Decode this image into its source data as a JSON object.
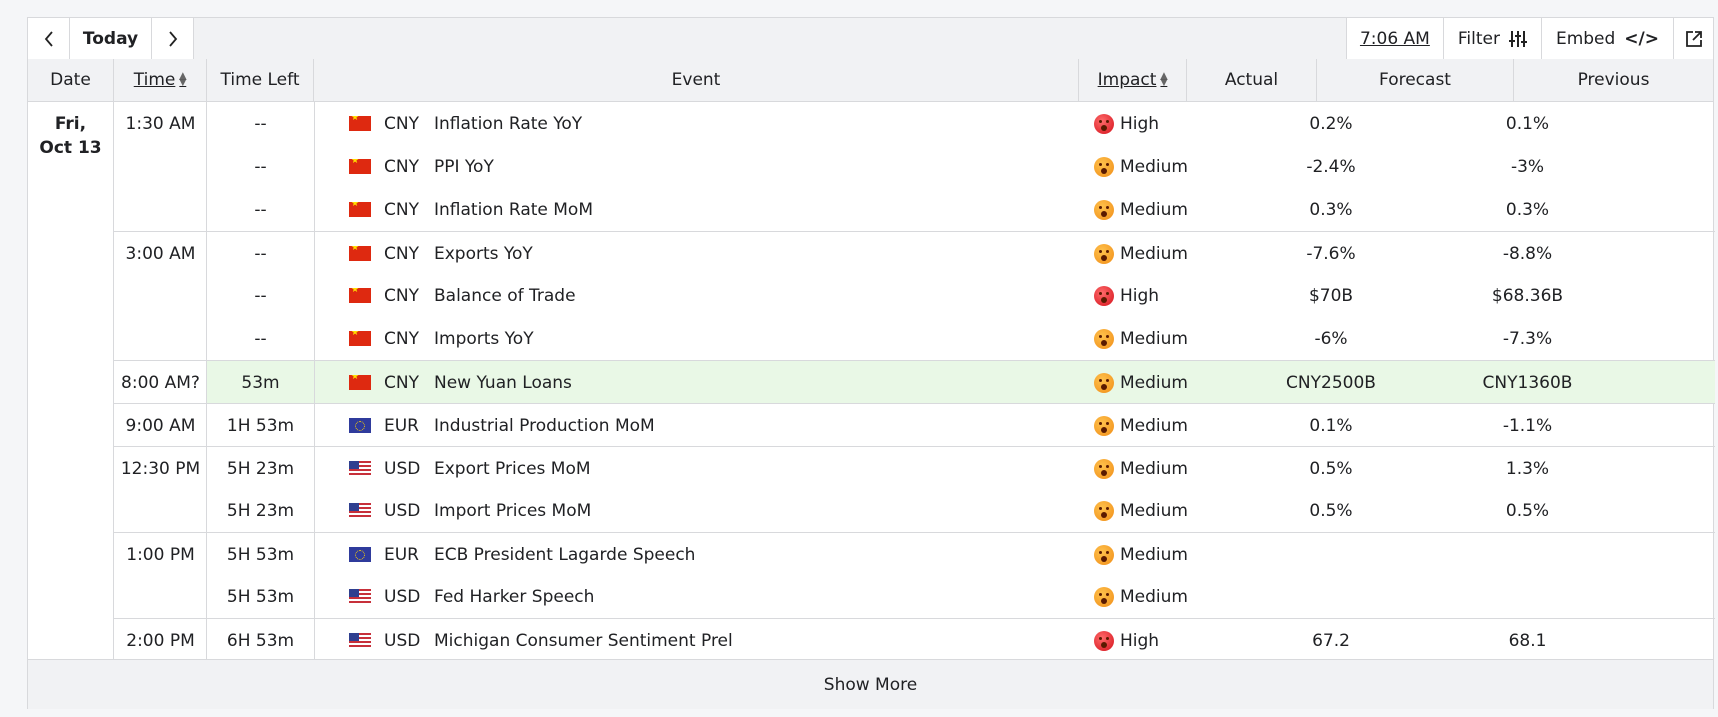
{
  "toolbar": {
    "today_label": "Today",
    "clock": "7:06 AM",
    "filter_label": "Filter",
    "embed_label": "Embed",
    "embed_code": "</>"
  },
  "headers": {
    "date": "Date",
    "time": "Time",
    "time_left": "Time Left",
    "event": "Event",
    "impact": "Impact",
    "actual": "Actual",
    "forecast": "Forecast",
    "previous": "Previous"
  },
  "date_group": {
    "weekday": "Fri,",
    "date": "Oct 13"
  },
  "rows": [
    {
      "time": "1:30 AM",
      "left": "--",
      "cur": "CNY",
      "flag": "cn",
      "event": "Inflation Rate YoY",
      "impact": "High",
      "actual": "",
      "forecast": "0.2%",
      "previous": "0.1%"
    },
    {
      "time": "",
      "left": "--",
      "cur": "CNY",
      "flag": "cn",
      "event": "PPI YoY",
      "impact": "Medium",
      "actual": "",
      "forecast": "-2.4%",
      "previous": "-3%"
    },
    {
      "time": "",
      "left": "--",
      "cur": "CNY",
      "flag": "cn",
      "event": "Inflation Rate MoM",
      "impact": "Medium",
      "actual": "",
      "forecast": "0.3%",
      "previous": "0.3%"
    },
    {
      "time": "3:00 AM",
      "left": "--",
      "cur": "CNY",
      "flag": "cn",
      "event": "Exports YoY",
      "impact": "Medium",
      "actual": "",
      "forecast": "-7.6%",
      "previous": "-8.8%"
    },
    {
      "time": "",
      "left": "--",
      "cur": "CNY",
      "flag": "cn",
      "event": "Balance of Trade",
      "impact": "High",
      "actual": "",
      "forecast": "$70B",
      "previous": "$68.36B"
    },
    {
      "time": "",
      "left": "--",
      "cur": "CNY",
      "flag": "cn",
      "event": "Imports YoY",
      "impact": "Medium",
      "actual": "",
      "forecast": "-6%",
      "previous": "-7.3%"
    },
    {
      "time": "8:00 AM?",
      "left": "53m",
      "cur": "CNY",
      "flag": "cn",
      "event": "New Yuan Loans",
      "impact": "Medium",
      "actual": "",
      "forecast": "CNY2500B",
      "previous": "CNY1360B"
    },
    {
      "time": "9:00 AM",
      "left": "1H 53m",
      "cur": "EUR",
      "flag": "eu",
      "event": "Industrial Production MoM",
      "impact": "Medium",
      "actual": "",
      "forecast": "0.1%",
      "previous": "-1.1%"
    },
    {
      "time": "12:30 PM",
      "left": "5H 23m",
      "cur": "USD",
      "flag": "us",
      "event": "Export Prices MoM",
      "impact": "Medium",
      "actual": "",
      "forecast": "0.5%",
      "previous": "1.3%"
    },
    {
      "time": "",
      "left": "5H 23m",
      "cur": "USD",
      "flag": "us",
      "event": "Import Prices MoM",
      "impact": "Medium",
      "actual": "",
      "forecast": "0.5%",
      "previous": "0.5%"
    },
    {
      "time": "1:00 PM",
      "left": "5H 53m",
      "cur": "EUR",
      "flag": "eu",
      "event": "ECB President Lagarde Speech",
      "impact": "Medium",
      "actual": "",
      "forecast": "",
      "previous": ""
    },
    {
      "time": "",
      "left": "5H 53m",
      "cur": "USD",
      "flag": "us",
      "event": "Fed Harker Speech",
      "impact": "Medium",
      "actual": "",
      "forecast": "",
      "previous": ""
    },
    {
      "time": "2:00 PM",
      "left": "6H 53m",
      "cur": "USD",
      "flag": "us",
      "event": "Michigan Consumer Sentiment Prel",
      "impact": "High",
      "actual": "",
      "forecast": "67.2",
      "previous": "68.1"
    }
  ],
  "highlight_row": 6,
  "footer": {
    "show_more": "Show More"
  },
  "colors": {
    "highlight": "#e9f8e6",
    "header_bg": "#f1f2f4",
    "border": "#d8d9dc",
    "high": "#d4101a",
    "medium": "#f08c16"
  }
}
